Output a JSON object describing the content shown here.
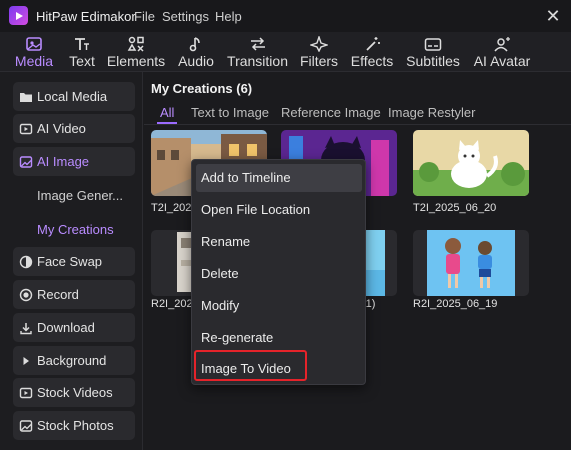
{
  "window": {
    "title": "HitPaw Edimakor",
    "close_glyph": "✕"
  },
  "menubar": [
    "File",
    "Settings",
    "Help"
  ],
  "toolbar": [
    {
      "label": "Media",
      "icon": "media-icon",
      "active": true
    },
    {
      "label": "Text",
      "icon": "text-icon"
    },
    {
      "label": "Elements",
      "icon": "elements-icon"
    },
    {
      "label": "Audio",
      "icon": "audio-icon"
    },
    {
      "label": "Transition",
      "icon": "transition-icon"
    },
    {
      "label": "Filters",
      "icon": "filters-icon"
    },
    {
      "label": "Effects",
      "icon": "effects-icon"
    },
    {
      "label": "Subtitles",
      "icon": "subtitles-icon"
    },
    {
      "label": "AI Avatar",
      "icon": "ai-avatar-icon"
    }
  ],
  "sidebar": {
    "items": [
      {
        "label": "Local Media",
        "icon": "folder-icon"
      },
      {
        "label": "AI Video",
        "icon": "ai-video-icon"
      },
      {
        "label": "AI Image",
        "icon": "ai-image-icon",
        "active": true
      },
      {
        "label": "Face Swap",
        "icon": "face-swap-icon"
      },
      {
        "label": "Record",
        "icon": "record-icon"
      },
      {
        "label": "Download",
        "icon": "download-icon"
      },
      {
        "label": "Background",
        "icon": "background-icon"
      },
      {
        "label": "Stock Videos",
        "icon": "stock-videos-icon"
      },
      {
        "label": "Stock Photos",
        "icon": "stock-photos-icon"
      }
    ],
    "subitems": [
      {
        "label": "Image Gener..."
      },
      {
        "label": "My Creations",
        "active": true
      }
    ]
  },
  "panel": {
    "title": "My Creations (6)",
    "tabs": [
      "All",
      "Text to Image",
      "Reference Image",
      "Image Restyler"
    ],
    "cards": [
      {
        "label": "T2I_202",
        "thumb": "street"
      },
      {
        "label": "",
        "thumb": "neon-cat"
      },
      {
        "label": "T2I_2025_06_20",
        "thumb": "white-cat"
      },
      {
        "label": "R2I_202",
        "thumb": "room"
      },
      {
        "label": "(1)",
        "thumb": "sky"
      },
      {
        "label": "R2I_2025_06_19",
        "thumb": "kids"
      }
    ]
  },
  "context_menu": {
    "items": [
      "Add to Timeline",
      "Open File Location",
      "Rename",
      "Delete",
      "Modify",
      "Re-generate",
      "Image To Video"
    ],
    "hovered_index": 0,
    "highlighted_index": 6,
    "highlight_color": "#e5232a"
  },
  "colors": {
    "accent": "#b98cff",
    "background": "#1b1b1e",
    "panel": "#2a2a2e"
  }
}
